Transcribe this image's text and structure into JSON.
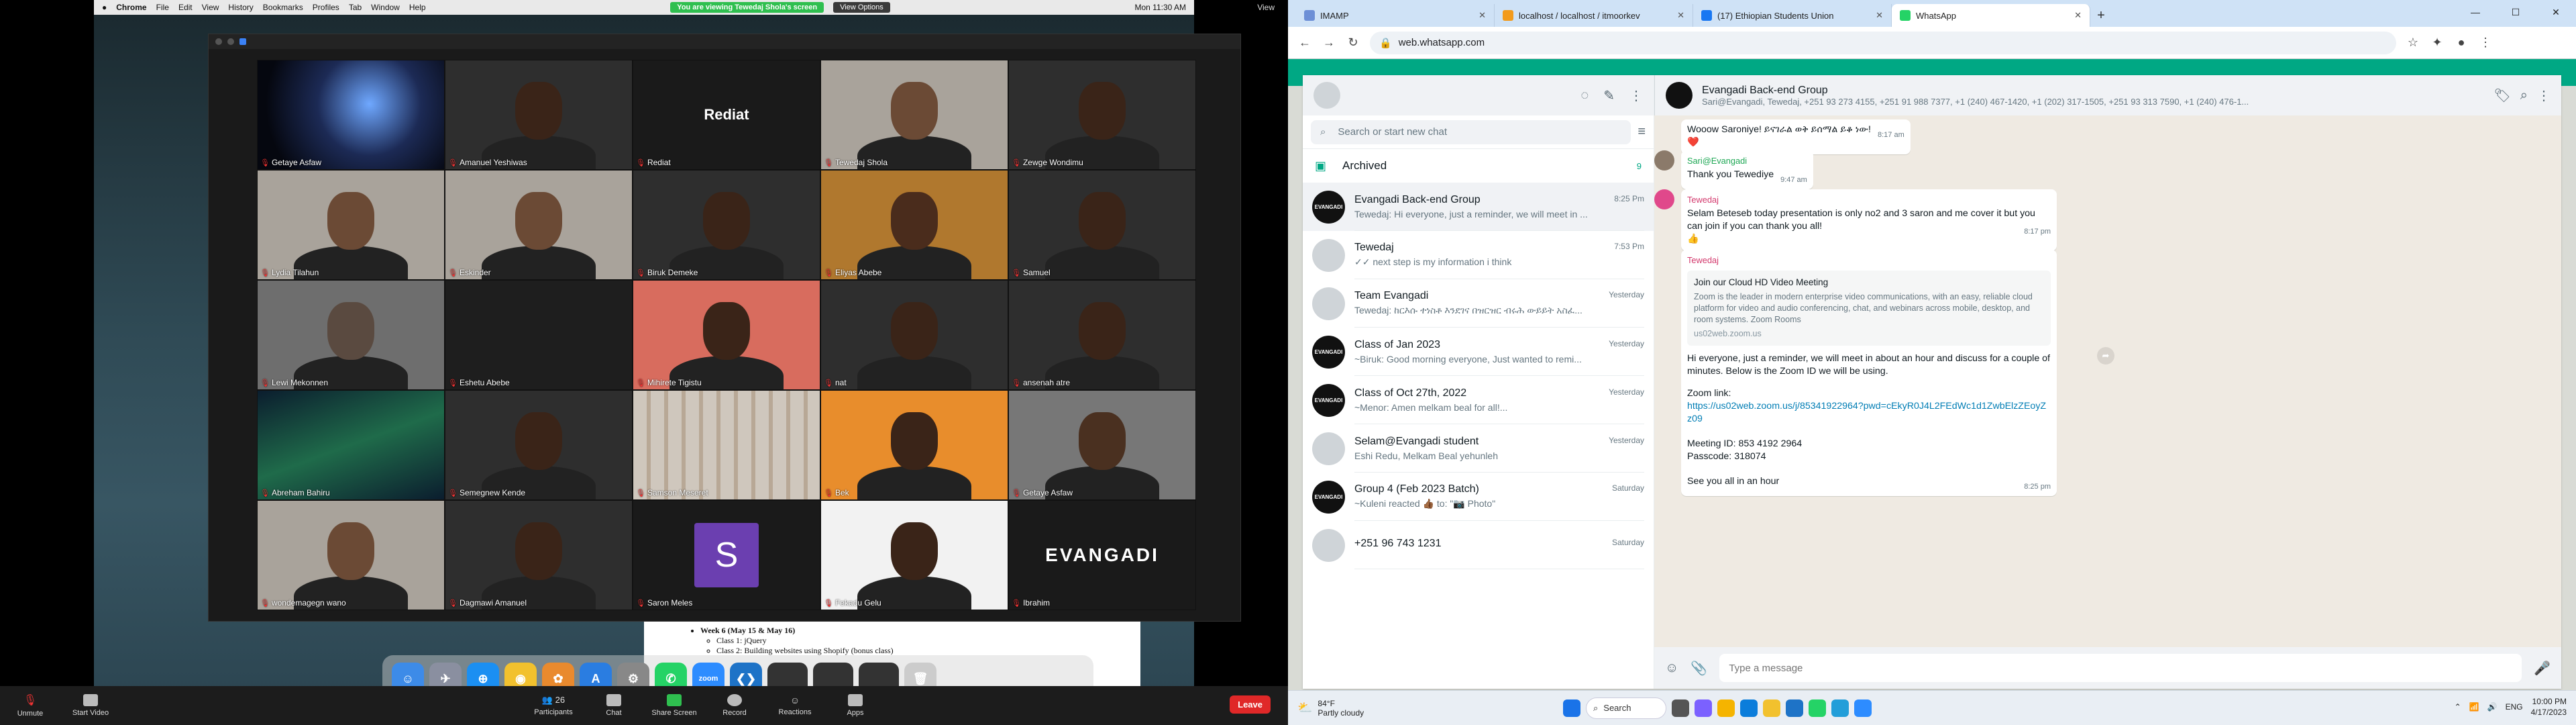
{
  "mac_menu": {
    "app": "Chrome",
    "items": [
      "File",
      "Edit",
      "View",
      "History",
      "Bookmarks",
      "Profiles",
      "Tab",
      "Window",
      "Help"
    ],
    "share_banner": "You are viewing Tewedaj Shola's screen",
    "view_options": "View Options",
    "time": "Mon 11:30 AM",
    "view_label": "View"
  },
  "zoom": {
    "participants": [
      {
        "name": "Getaye Asfaw",
        "kind": "space"
      },
      {
        "name": "Amanuel Yeshiwas",
        "kind": "person"
      },
      {
        "name": "Rediat",
        "kind": "text",
        "display": "Rediat"
      },
      {
        "name": "Tewedaj Shola",
        "kind": "person-light"
      },
      {
        "name": "Zewge Wondimu",
        "kind": "person"
      },
      {
        "name": "Lydia Tilahun",
        "kind": "person-light"
      },
      {
        "name": "Eskinder",
        "kind": "person-light"
      },
      {
        "name": "Biruk Demeke",
        "kind": "person"
      },
      {
        "name": "Eliyas Abebe",
        "kind": "person-warm"
      },
      {
        "name": "Samuel",
        "kind": "person"
      },
      {
        "name": "Lewi Mekonnen",
        "kind": "person-dim"
      },
      {
        "name": "Eshetu Abebe",
        "kind": "dark"
      },
      {
        "name": "Mihirete Tigistu",
        "kind": "person-red"
      },
      {
        "name": "nat",
        "kind": "person"
      },
      {
        "name": "ansenah atre",
        "kind": "person"
      },
      {
        "name": "Abreham Bahiru",
        "kind": "aurora"
      },
      {
        "name": "Semegnew Kende",
        "kind": "person"
      },
      {
        "name": "Samson Meseret",
        "kind": "shelf"
      },
      {
        "name": "Bek",
        "kind": "person-orange"
      },
      {
        "name": "Getaye Asfaw",
        "kind": "person-small"
      },
      {
        "name": "wondemagegn wano",
        "kind": "person-light"
      },
      {
        "name": "Dagmawi Amanuel",
        "kind": "person"
      },
      {
        "name": "Saron Meles",
        "kind": "letter",
        "display": "S"
      },
      {
        "name": "Fekadu Gelu",
        "kind": "person-id"
      },
      {
        "name": "Ibrahim",
        "kind": "evangadi",
        "display": "EVANGADI"
      }
    ],
    "doc": {
      "week": "Week 6 (May 15 & May 16)",
      "class1": "Class 1: jQuery",
      "class2": "Class 2: Building websites using Shopify (bonus class)"
    },
    "toolbar": {
      "unmute": "Unmute",
      "start_video": "Start Video",
      "participants": "Participants",
      "participants_count": "26",
      "chat": "Chat",
      "share_screen": "Share Screen",
      "record": "Record",
      "reactions": "Reactions",
      "apps": "Apps",
      "leave": "Leave"
    }
  },
  "browser": {
    "tabs": [
      {
        "label": "IMAMP",
        "color": "#6d8fd6"
      },
      {
        "label": "localhost / localhost / itmoorkev",
        "color": "#f29b1d"
      },
      {
        "label": "(17) Ethiopian Students Union",
        "color": "#1877f2"
      },
      {
        "label": "WhatsApp",
        "color": "#25d366"
      }
    ],
    "url": "web.whatsapp.com"
  },
  "whatsapp": {
    "search_placeholder": "Search or start new chat",
    "archived": "Archived",
    "archived_count": "9",
    "chats": [
      {
        "name": "Evangadi Back-end Group",
        "time": "8:25 Pm",
        "preview": "Tewedaj: Hi everyone, just a reminder, we will meet in ...",
        "avatar": "EVANGADI",
        "selected": true
      },
      {
        "name": "Tewedaj",
        "time": "7:53 Pm",
        "preview": "✓✓ next step is my information i think",
        "avatar": "",
        "selected": false
      },
      {
        "name": "Team Evangadi",
        "time": "Yesterday",
        "preview": "Tewedaj: ከርእሱ ተነስቶ እንደገና በዝርዝር ብሩሕ ውይይት አስፈ...",
        "avatar": "",
        "selected": false
      },
      {
        "name": "Class of Jan 2023",
        "time": "Yesterday",
        "preview": "~Biruk: Good morning everyone, Just wanted to remi...",
        "avatar": "EVANGADI",
        "selected": false
      },
      {
        "name": "Class of Oct 27th, 2022",
        "time": "Yesterday",
        "preview": "~Menor: Amen melkam beal for all!...",
        "avatar": "EVANGADI",
        "selected": false
      },
      {
        "name": "Selam@Evangadi student",
        "time": "Yesterday",
        "preview": "Eshi Redu, Melkam Beal yehunleh",
        "avatar": "",
        "selected": false
      },
      {
        "name": "Group 4 (Feb 2023 Batch)",
        "time": "Saturday",
        "preview": "~Kuleni reacted 👍🏾 to: \"📷 Photo\"",
        "avatar": "EVANGADI",
        "selected": false
      },
      {
        "name": "+251 96 743 1231",
        "time": "Saturday",
        "preview": "",
        "avatar": "",
        "selected": false
      }
    ],
    "conversation": {
      "name": "Evangadi Back-end Group",
      "members": "Sari@Evangadi, Tewedaj, +251 93 273 4155, +251 91 988 7377, +1 (240) 467-1420, +1 (202) 317-1505, +251 93 313 7590, +1 (240) 476-1...",
      "messages": [
        {
          "sender": "",
          "text": "Wooow Saroniye! ይናገራል ወቅ ይሰማል ይቆ ነው!",
          "time": "8:17 am",
          "extra": "❤️"
        },
        {
          "sender": "Sari@Evangadi",
          "text": "Thank you Tewediye",
          "time": "9:47 am",
          "extra": ""
        },
        {
          "sender": "Tewedaj",
          "text": "Selam Beteseb today presentation is only no2 and 3 saron and me cover it but you can join if you can thank you all!",
          "time": "8:17 pm",
          "extra": "👍"
        },
        {
          "sender": "Tewedaj",
          "preview_title": "Join our Cloud HD Video Meeting",
          "preview_desc": "Zoom is the leader in modern enterprise video communications, with an easy, reliable cloud platform for video and audio conferencing, chat, and webinars across mobile, desktop, and room systems. Zoom Rooms",
          "preview_domain": "us02web.zoom.us",
          "text": "Hi everyone, just a reminder, we will meet in about an hour and discuss for a couple of minutes. Below is the Zoom ID we will be using.",
          "zoom_link_label": "Zoom link:",
          "zoom_link": "https://us02web.zoom.us/j/85341922964?pwd=cEkyR0J4L2FEdWc1d1ZwbElzZEoyZz09",
          "meeting_id": "Meeting ID: 853 4192 2964",
          "passcode": "Passcode: 318074",
          "closing": "See you all in an hour",
          "time": "8:25 pm"
        }
      ],
      "composer_placeholder": "Type a message"
    }
  },
  "taskbar": {
    "temp": "84°F",
    "condition": "Partly cloudy",
    "search": "Search",
    "lang": "ENG",
    "time": "10:00 PM",
    "date": "4/17/2023"
  }
}
